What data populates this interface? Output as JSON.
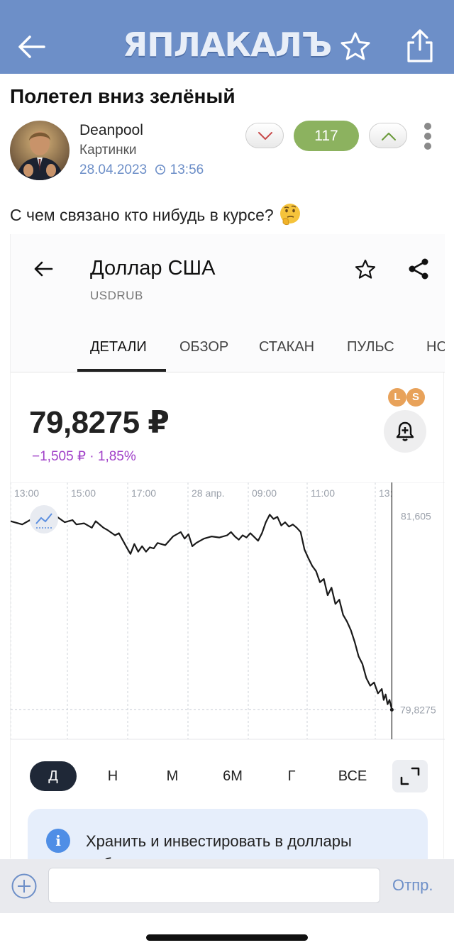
{
  "appbar": {
    "logo": "ЯПЛАКАЛЪ",
    "back_icon": "back-arrow-icon",
    "star_icon": "star-icon",
    "share_icon": "share-icon",
    "color": "#6d8fc8"
  },
  "post": {
    "title": "Полетел вниз зелёный",
    "author": "Deanpool",
    "category": "Картинки",
    "date": "28.04.2023",
    "time": "13:56",
    "rating": "117",
    "text": "С чем связано кто нибудь в курсе?",
    "emoji": "thinking-face-emoji",
    "rating_color": "#8cb25f"
  },
  "shot": {
    "title": "Доллар США",
    "ticker": "USDRUB",
    "tabs": [
      "ДЕТАЛИ",
      "ОБЗОР",
      "СТАКАН",
      "ПУЛЬС",
      "НС"
    ],
    "active_tab": "ДЕТАЛИ",
    "price": "79,8275 ₽",
    "change": "−1,505 ₽ · 1,85%",
    "change_color": "#a040c8",
    "badges": [
      "L",
      "S"
    ],
    "periods": [
      "Д",
      "Н",
      "М",
      "6М",
      "Г",
      "ВСЕ"
    ],
    "active_period": "Д",
    "info_text": "Хранить и инвестировать в доллары небезопасно"
  },
  "chart_data": {
    "type": "line",
    "x_ticks": [
      "13:00",
      "15:00",
      "17:00",
      "28 апр.",
      "09:00",
      "11:00",
      "13:"
    ],
    "y_labels": [
      "81,605",
      "79,8275"
    ],
    "ylim": [
      79.78,
      81.72
    ],
    "xlim": [
      0,
      100
    ],
    "grid": true,
    "series": [
      {
        "x": [
          0,
          3,
          5,
          7,
          9,
          11,
          12,
          14,
          16,
          17,
          19,
          21,
          22,
          24,
          25,
          27,
          28,
          30,
          31,
          32,
          33,
          34,
          35,
          36,
          37,
          38,
          40,
          42,
          44,
          45,
          46,
          47,
          48,
          49,
          50,
          52,
          54,
          56,
          57,
          58,
          59,
          60,
          61,
          62,
          64,
          65,
          66,
          67,
          68,
          69,
          70,
          71,
          72,
          73,
          74,
          75,
          76,
          77,
          78,
          79,
          80,
          81,
          82,
          83,
          84,
          85,
          86,
          87,
          88,
          89,
          90,
          91,
          92,
          93,
          94,
          95,
          96,
          96.5,
          97,
          97.5,
          98,
          98.6
        ],
        "y": [
          81.56,
          81.53,
          81.57,
          81.56,
          81.55,
          81.52,
          81.6,
          81.55,
          81.57,
          81.53,
          81.54,
          81.5,
          81.56,
          81.5,
          81.48,
          81.43,
          81.45,
          81.32,
          81.26,
          81.35,
          81.28,
          81.33,
          81.28,
          81.32,
          81.31,
          81.36,
          81.34,
          81.42,
          81.46,
          81.4,
          81.44,
          81.33,
          81.36,
          81.38,
          81.4,
          81.42,
          81.41,
          81.43,
          81.46,
          81.42,
          81.39,
          81.43,
          81.41,
          81.45,
          81.38,
          81.45,
          81.55,
          81.62,
          81.58,
          81.6,
          81.52,
          81.55,
          81.51,
          81.53,
          81.5,
          81.46,
          81.3,
          81.22,
          81.15,
          81.1,
          81.0,
          81.03,
          80.88,
          80.95,
          80.8,
          80.84,
          80.7,
          80.64,
          80.56,
          80.45,
          80.32,
          80.25,
          80.12,
          80.05,
          80.08,
          79.98,
          80.02,
          79.92,
          79.97,
          79.88,
          79.92,
          79.83
        ]
      }
    ]
  },
  "compose": {
    "placeholder": "",
    "send_label": "Отпр."
  }
}
